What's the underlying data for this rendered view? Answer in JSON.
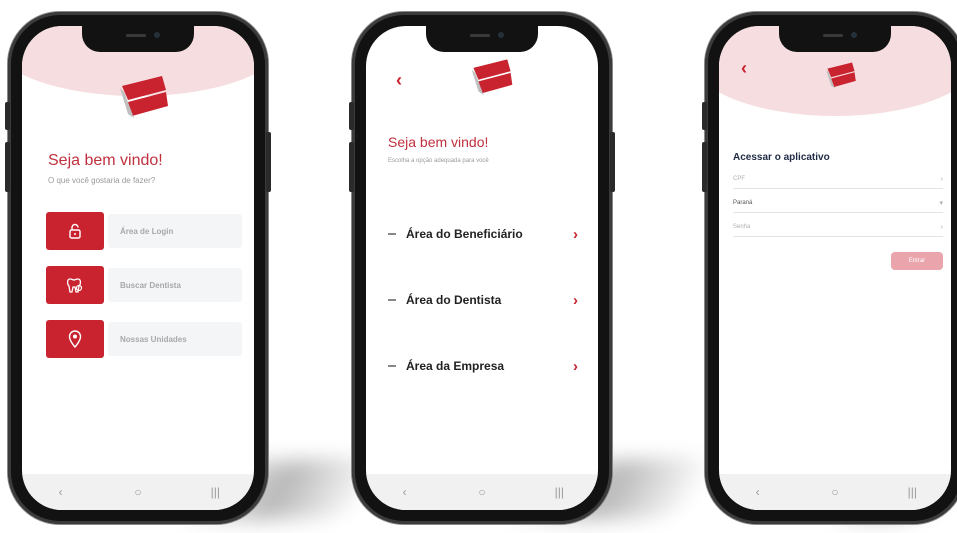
{
  "screen1": {
    "welcome": "Seja bem vindo!",
    "subtitle": "O que você gostaria de fazer?",
    "menu": [
      {
        "label": "Área de Login",
        "icon": "lock-icon"
      },
      {
        "label": "Buscar Dentista",
        "icon": "tooth-icon"
      },
      {
        "label": "Nossas Unidades",
        "icon": "location-pin-icon"
      }
    ]
  },
  "screen2": {
    "welcome": "Seja bem vindo!",
    "subtitle": "Escolha a opção adequada para você",
    "areas": [
      "Área do Beneficiário",
      "Área do Dentista",
      "Área da Empresa"
    ]
  },
  "screen3": {
    "title": "Acessar o aplicativo",
    "fields": [
      {
        "value": "",
        "placeholder": "CPF"
      },
      {
        "value": "Paraná",
        "placeholder": ""
      },
      {
        "value": "",
        "placeholder": "Senha"
      }
    ],
    "submit": "Entrar"
  },
  "nav": {
    "back": "‹",
    "home": "○",
    "recents": "|||"
  },
  "colors": {
    "brand": "#c8232f",
    "brand_light": "#f6dde0"
  }
}
